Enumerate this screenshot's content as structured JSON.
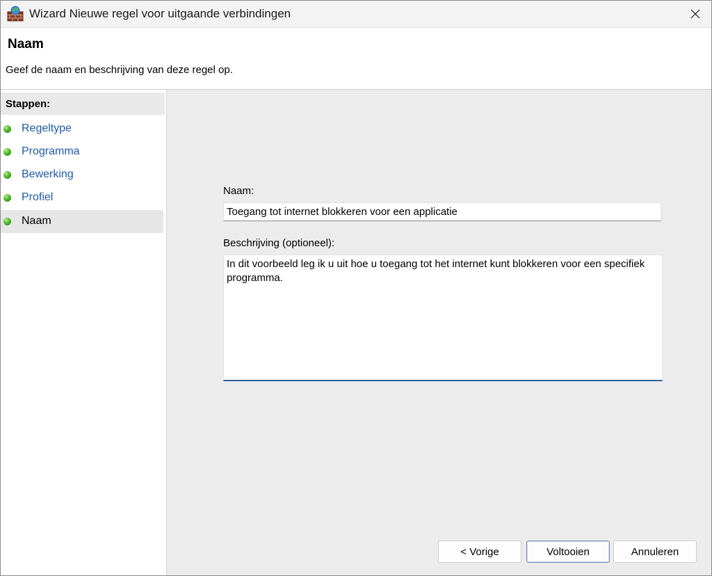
{
  "window": {
    "title": "Wizard Nieuwe regel voor uitgaande verbindingen",
    "icons": {
      "app": "firewall-app-icon",
      "close": "close-icon"
    }
  },
  "header": {
    "title": "Naam",
    "subtitle": "Geef de naam en beschrijving van deze regel op."
  },
  "sidebar": {
    "heading": "Stappen:",
    "step_icon": "green-dot-icon",
    "items": [
      {
        "label": "Regeltype",
        "active": false
      },
      {
        "label": "Programma",
        "active": false
      },
      {
        "label": "Bewerking",
        "active": false
      },
      {
        "label": "Profiel",
        "active": false
      },
      {
        "label": "Naam",
        "active": true
      }
    ]
  },
  "form": {
    "name_label": "Naam:",
    "name_value": "Toegang tot internet blokkeren voor een applicatie",
    "description_label": "Beschrijving (optioneel):",
    "description_value": "In dit voorbeeld leg ik u uit hoe u toegang tot het internet kunt blokkeren voor een specifiek programma."
  },
  "buttons": {
    "back": "< Vorige",
    "finish": "Voltooien",
    "cancel": "Annuleren"
  },
  "colors": {
    "link_blue": "#1f5aa6",
    "panel_gray": "#ececec",
    "focus_blue": "#2a5f9e"
  }
}
